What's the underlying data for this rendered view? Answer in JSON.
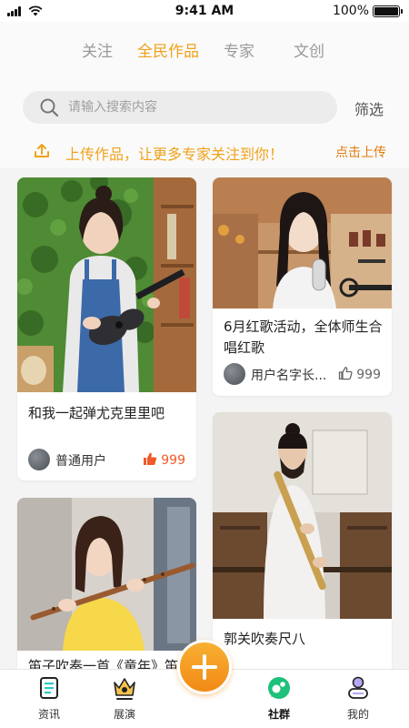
{
  "status_bar": {
    "time": "9:41 AM",
    "battery": "100%"
  },
  "tabs": [
    {
      "label": "关注",
      "active": false
    },
    {
      "label": "全民作品",
      "active": true
    },
    {
      "label": "专家",
      "active": false
    },
    {
      "label": "文创",
      "active": false
    }
  ],
  "search": {
    "placeholder": "请输入搜索内容",
    "filter_label": "筛选"
  },
  "upload": {
    "text": "上传作品，让更多专家关注到你！",
    "link": "点击上传"
  },
  "feed": {
    "left": [
      {
        "title": "和我一起弹尤克里里吧",
        "user": "普通用户",
        "likes": "999"
      },
      {
        "title": "笛子吹奏一首《童年》笛"
      }
    ],
    "right": [
      {
        "title": "6月红歌活动，全体师生合唱红歌",
        "user": "用户名字长...",
        "likes": "999"
      },
      {
        "title": "郭关吹奏尺八"
      }
    ]
  },
  "bottom_nav": [
    {
      "label": "资讯",
      "icon": "news-icon",
      "active": false
    },
    {
      "label": "展演",
      "icon": "performance-icon",
      "active": false
    },
    {
      "label": "社群",
      "icon": "community-icon",
      "active": true
    },
    {
      "label": "我的",
      "icon": "profile-icon",
      "active": false
    }
  ],
  "fab": {
    "icon": "plus-icon"
  },
  "colors": {
    "accent": "#f0a21c",
    "like": "#f05a2a",
    "community": "#1fc07a"
  }
}
